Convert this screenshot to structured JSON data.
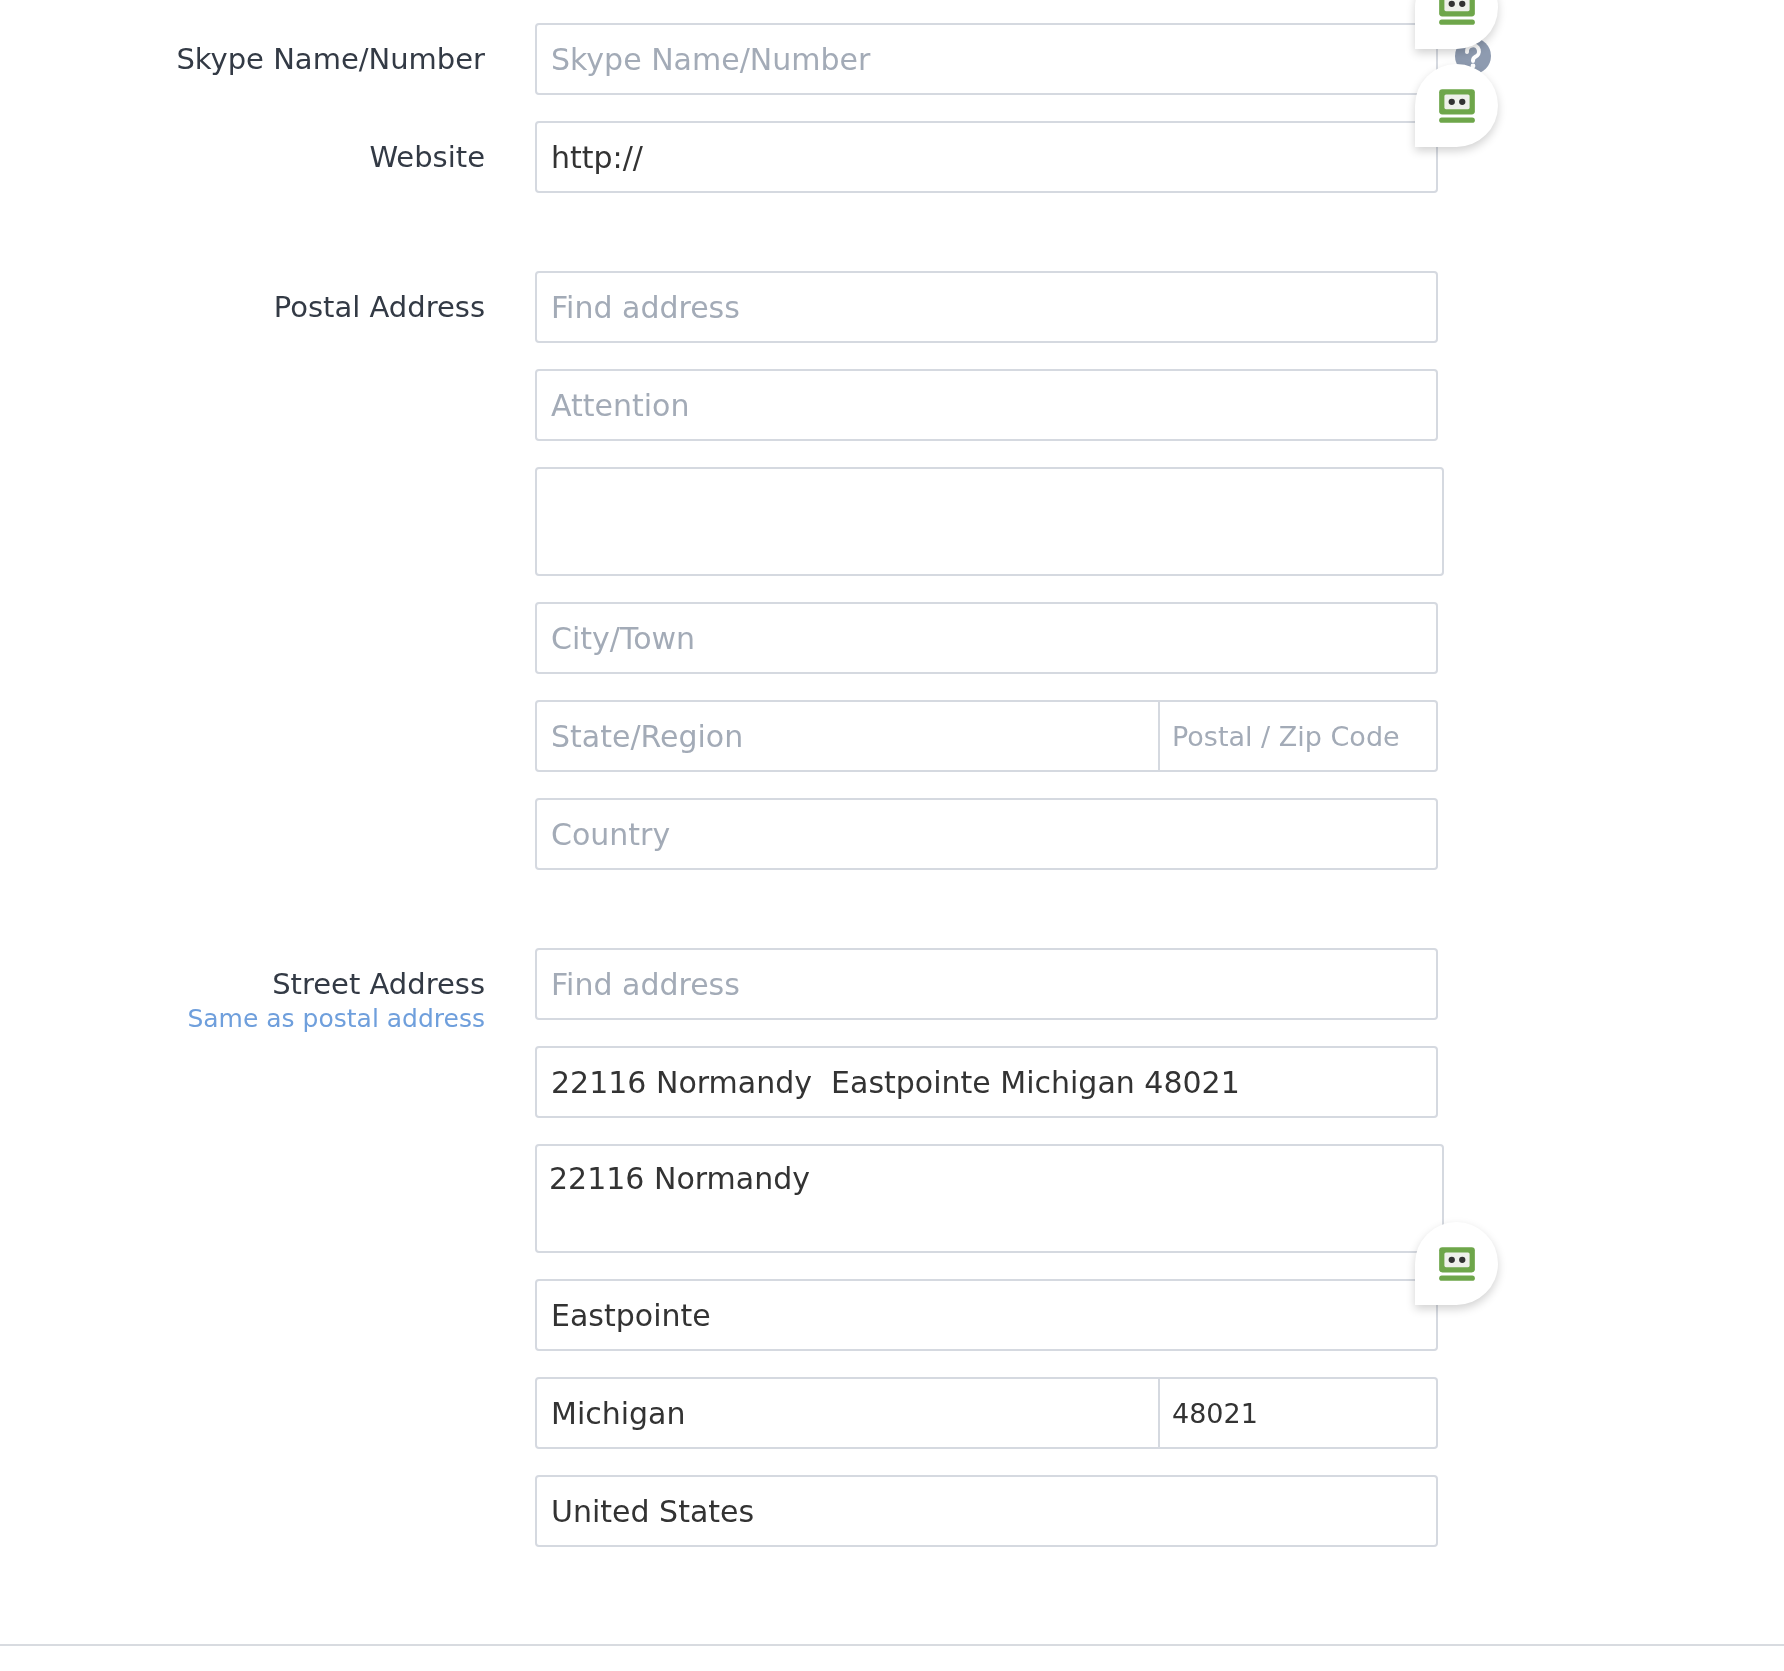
{
  "groups": [
    {
      "sections": [
        {
          "label": "Skype Name/Number",
          "fields": [
            {
              "kind": "input",
              "placeholder": "Skype Name/Number",
              "badge": true,
              "help": true
            }
          ]
        },
        {
          "label": "Website",
          "fields": [
            {
              "kind": "input",
              "value": "http://",
              "badge": true,
              "help": false
            }
          ]
        }
      ]
    },
    {
      "sections": [
        {
          "label": "Postal Address",
          "fields": [
            {
              "kind": "input",
              "placeholder": "Find address",
              "badge": false,
              "help": false
            },
            {
              "kind": "input",
              "placeholder": "Attention",
              "badge": false,
              "help": false
            },
            {
              "kind": "textarea",
              "badge": false,
              "help": false
            },
            {
              "kind": "input",
              "placeholder": "City/Town",
              "badge": false,
              "help": false
            },
            {
              "kind": "pair",
              "left": {
                "placeholder": "State/Region"
              },
              "right": {
                "placeholder": "Postal / Zip Code"
              },
              "badge": false,
              "help": false
            },
            {
              "kind": "input",
              "placeholder": "Country",
              "badge": false,
              "help": false
            }
          ]
        }
      ]
    },
    {
      "sections": [
        {
          "label": "Street Address",
          "link": "Same as postal address",
          "fields": [
            {
              "kind": "input",
              "placeholder": "Find address",
              "badge": false,
              "help": false
            },
            {
              "kind": "input",
              "value": "22116 Normandy  Eastpointe Michigan 48021",
              "badge": false,
              "help": false
            },
            {
              "kind": "textarea",
              "value": "22116 Normandy",
              "badge": false,
              "help": false
            },
            {
              "kind": "input",
              "value": "Eastpointe",
              "badge": true,
              "help": false
            },
            {
              "kind": "pair",
              "left": {
                "value": "Michigan"
              },
              "right": {
                "value": "48021"
              },
              "badge": false,
              "help": false
            },
            {
              "kind": "input",
              "value": "United States",
              "badge": false,
              "help": false
            }
          ]
        }
      ]
    }
  ]
}
